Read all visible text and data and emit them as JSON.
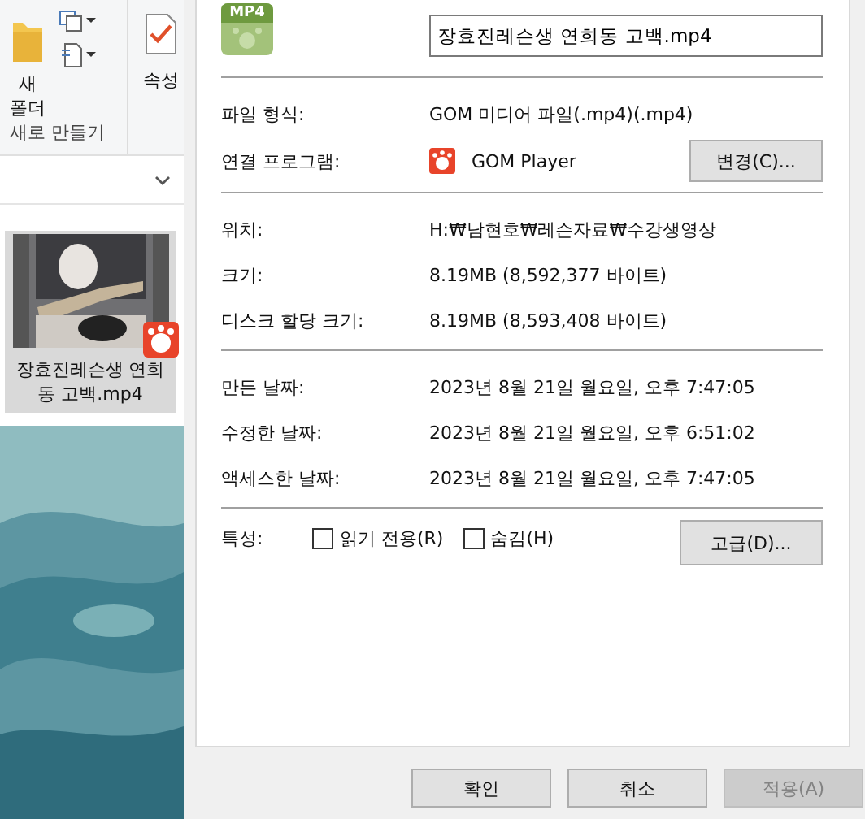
{
  "explorer": {
    "ribbon": {
      "new_folder": "새 폴더",
      "group_label": "새로 만들기",
      "properties": "속성"
    },
    "file": {
      "name": "장효진레슨생 연희동 고백.mp4",
      "selected": true
    }
  },
  "dialog": {
    "icon_label": "MP4",
    "file_name": "장효진레슨생 연희동 고백.mp4",
    "sections": [
      {
        "rows": [
          {
            "label": "파일 형식:",
            "value": "GOM 미디어 파일(.mp4)(.mp4)"
          },
          {
            "label": "연결 프로그램:",
            "value": "GOM Player",
            "app_icon": true,
            "button": "변경(C)..."
          }
        ]
      },
      {
        "rows": [
          {
            "label": "위치:",
            "value": "H:₩남현호₩레슨자료₩수강생영상"
          },
          {
            "label": "크기:",
            "value": "8.19MB (8,592,377 바이트)"
          },
          {
            "label": "디스크 할당 크기:",
            "value": "8.19MB (8,593,408 바이트)"
          }
        ]
      },
      {
        "rows": [
          {
            "label": "만든 날짜:",
            "value": "2023년 8월 21일 월요일, 오후 7:47:05"
          },
          {
            "label": "수정한 날짜:",
            "value": "2023년 8월 21일 월요일, 오후 6:51:02"
          },
          {
            "label": "액세스한 날짜:",
            "value": "2023년 8월 21일 월요일, 오후 7:47:05"
          }
        ]
      }
    ],
    "attributes": {
      "label": "특성:",
      "checkboxes": [
        {
          "label": "읽기 전용(R)",
          "checked": false
        },
        {
          "label": "숨김(H)",
          "checked": false
        }
      ],
      "button": "고급(D)..."
    },
    "buttons": [
      {
        "label": "확인",
        "disabled": false
      },
      {
        "label": "취소",
        "disabled": false
      },
      {
        "label": "적용(A)",
        "disabled": true
      }
    ]
  }
}
